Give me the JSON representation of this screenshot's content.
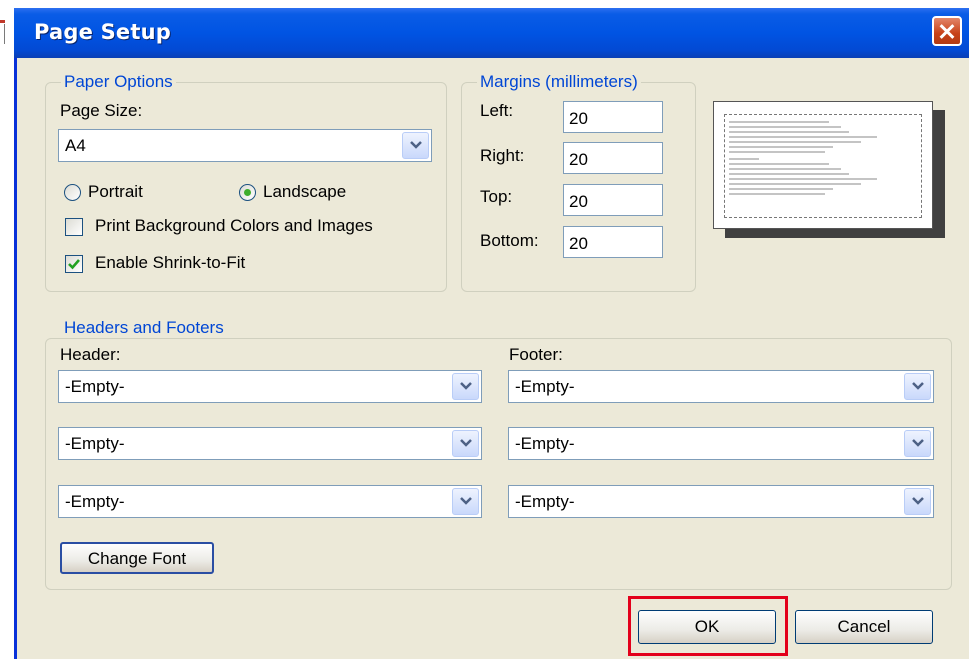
{
  "dialog": {
    "title": "Page Setup"
  },
  "paper_options": {
    "legend": "Paper Options",
    "page_size_label": "Page Size:",
    "page_size_value": "A4",
    "orientation": {
      "portrait_label": "Portrait",
      "landscape_label": "Landscape",
      "selected": "Landscape"
    },
    "print_background": {
      "label": "Print Background Colors and Images",
      "checked": false
    },
    "shrink_to_fit": {
      "label": "Enable Shrink-to-Fit",
      "checked": true
    }
  },
  "margins": {
    "legend": "Margins (millimeters)",
    "left": {
      "label": "Left:",
      "value": "20"
    },
    "right": {
      "label": "Right:",
      "value": "20"
    },
    "top": {
      "label": "Top:",
      "value": "20"
    },
    "bottom": {
      "label": "Bottom:",
      "value": "20"
    }
  },
  "headers_footers": {
    "legend": "Headers and Footers",
    "header_label": "Header:",
    "footer_label": "Footer:",
    "header_values": [
      "-Empty-",
      "-Empty-",
      "-Empty-"
    ],
    "footer_values": [
      "-Empty-",
      "-Empty-",
      "-Empty-"
    ],
    "change_font_label": "Change Font"
  },
  "buttons": {
    "ok_label": "OK",
    "cancel_label": "Cancel"
  },
  "icons": {
    "close": "close-icon",
    "dropdown": "chevron-down-icon",
    "check": "checkmark-icon"
  },
  "colors": {
    "title_bar": "#0054e3",
    "dialog_background": "#ece9d8",
    "group_legend": "#0046d5",
    "ok_highlight": "#e3001b",
    "close_button": "#c74118"
  }
}
